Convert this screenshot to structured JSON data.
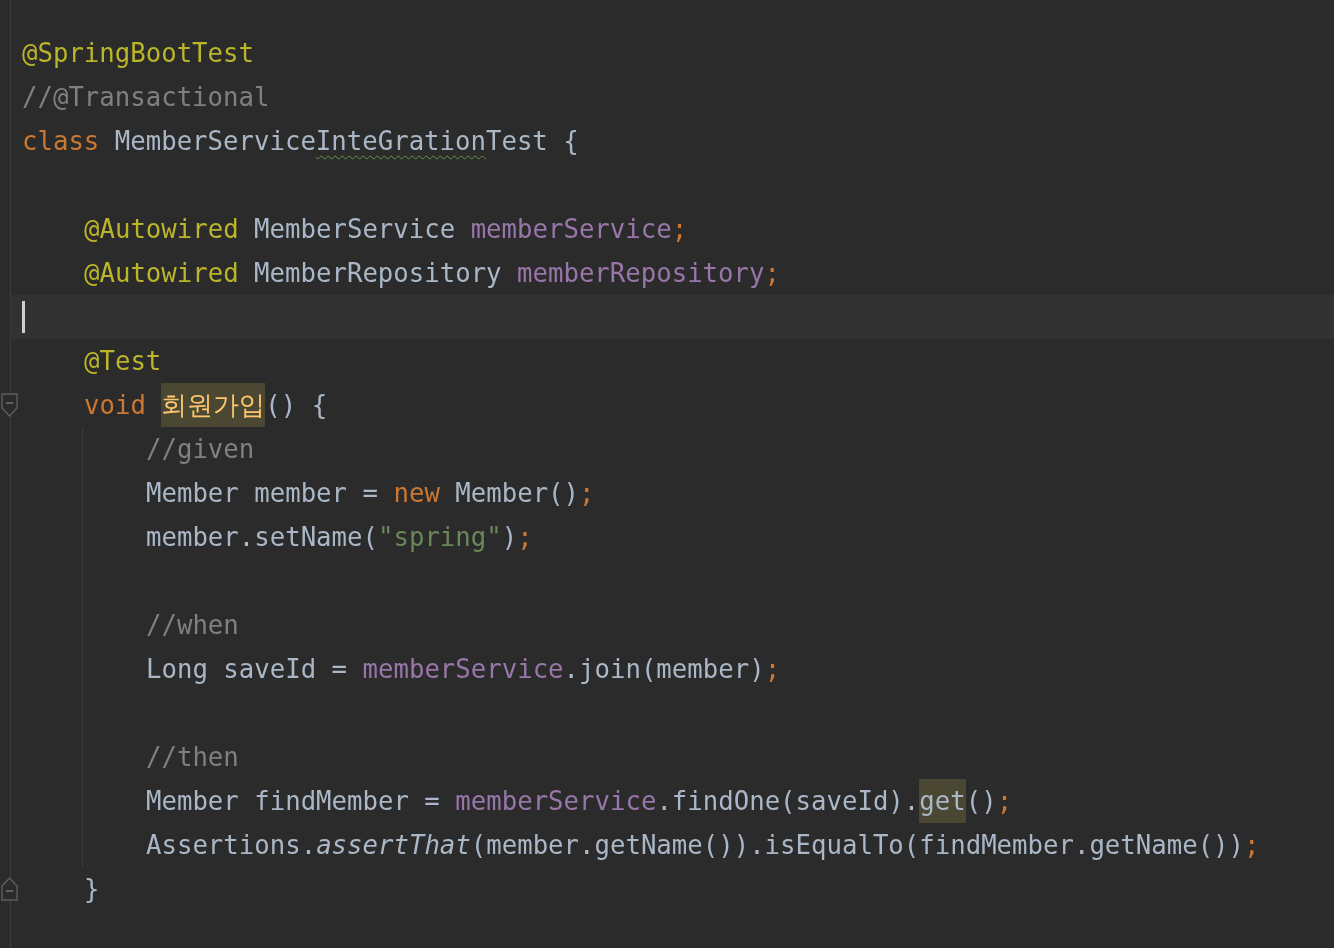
{
  "lines": [
    {
      "kind": "code",
      "current": false,
      "tokens": [
        {
          "text": "@SpringBootTest",
          "kind": "annotation"
        }
      ]
    },
    {
      "kind": "code",
      "current": false,
      "tokens": [
        {
          "text": "//@Transactional",
          "kind": "comment"
        }
      ]
    },
    {
      "kind": "code",
      "current": false,
      "tokens": [
        {
          "text": "class",
          "kind": "keyword"
        },
        {
          "text": " MemberService",
          "kind": "plain"
        },
        {
          "text": "InteGration",
          "kind": "plain",
          "misspelled": true
        },
        {
          "text": "Test {",
          "kind": "plain"
        }
      ],
      "children": [
        {
          "kind": "blank",
          "current": false
        },
        {
          "kind": "code",
          "current": false,
          "tokens": [
            {
              "text": "@Autowired",
              "kind": "annotation"
            },
            {
              "text": " MemberService ",
              "kind": "plain"
            },
            {
              "text": "memberService",
              "kind": "field"
            },
            {
              "text": ";",
              "kind": "punct"
            }
          ]
        },
        {
          "kind": "code",
          "current": false,
          "tokens": [
            {
              "text": "@Autowired",
              "kind": "annotation"
            },
            {
              "text": " MemberRepository ",
              "kind": "plain"
            },
            {
              "text": "memberRepository",
              "kind": "field"
            },
            {
              "text": ";",
              "kind": "punct"
            }
          ]
        },
        {
          "kind": "blank",
          "current": true
        },
        {
          "kind": "code",
          "current": false,
          "tokens": [
            {
              "text": "@Test",
              "kind": "annotation"
            }
          ]
        },
        {
          "kind": "fold-start",
          "current": false,
          "tokens": [
            {
              "text": "void ",
              "kind": "keyword"
            },
            {
              "text": "회원가입",
              "kind": "method",
              "highlighted": true
            },
            {
              "text": "() {",
              "kind": "plain"
            }
          ],
          "children": [
            {
              "kind": "code",
              "current": false,
              "tokens": [
                {
                  "text": "//given",
                  "kind": "comment"
                }
              ]
            },
            {
              "kind": "code",
              "current": false,
              "tokens": [
                {
                  "text": "Member member = ",
                  "kind": "plain"
                },
                {
                  "text": "new",
                  "kind": "keyword"
                },
                {
                  "text": " Member()",
                  "kind": "plain"
                },
                {
                  "text": ";",
                  "kind": "punct"
                }
              ]
            },
            {
              "kind": "code",
              "current": false,
              "tokens": [
                {
                  "text": "member.setName(",
                  "kind": "plain"
                },
                {
                  "text": "\"spring\"",
                  "kind": "string"
                },
                {
                  "text": ")",
                  "kind": "plain"
                },
                {
                  "text": ";",
                  "kind": "punct"
                }
              ]
            },
            {
              "kind": "blank",
              "current": false
            },
            {
              "kind": "code",
              "current": false,
              "tokens": [
                {
                  "text": "//when",
                  "kind": "comment"
                }
              ]
            },
            {
              "kind": "code",
              "current": false,
              "tokens": [
                {
                  "text": "Long saveId = ",
                  "kind": "plain"
                },
                {
                  "text": "memberService",
                  "kind": "field"
                },
                {
                  "text": ".join(member)",
                  "kind": "plain"
                },
                {
                  "text": ";",
                  "kind": "punct"
                }
              ]
            },
            {
              "kind": "blank",
              "current": false
            },
            {
              "kind": "code",
              "current": false,
              "tokens": [
                {
                  "text": "//then",
                  "kind": "comment"
                }
              ]
            },
            {
              "kind": "code",
              "current": false,
              "tokens": [
                {
                  "text": "Member findMember = ",
                  "kind": "plain"
                },
                {
                  "text": "memberService",
                  "kind": "field"
                },
                {
                  "text": ".findOne(saveId).",
                  "kind": "plain"
                },
                {
                  "text": "get",
                  "kind": "plain",
                  "highlighted": true
                },
                {
                  "text": "()",
                  "kind": "plain"
                },
                {
                  "text": ";",
                  "kind": "punct"
                }
              ]
            },
            {
              "kind": "code",
              "current": false,
              "tokens": [
                {
                  "text": "Assertions.",
                  "kind": "plain"
                },
                {
                  "text": "assertThat",
                  "kind": "static"
                },
                {
                  "text": "(member.getName()).isEqualTo(findMember.getName())",
                  "kind": "plain"
                },
                {
                  "text": ";",
                  "kind": "punct"
                }
              ]
            }
          ]
        },
        {
          "kind": "fold-end",
          "current": false,
          "tokens": [
            {
              "text": "}",
              "kind": "plain"
            }
          ]
        }
      ]
    }
  ]
}
